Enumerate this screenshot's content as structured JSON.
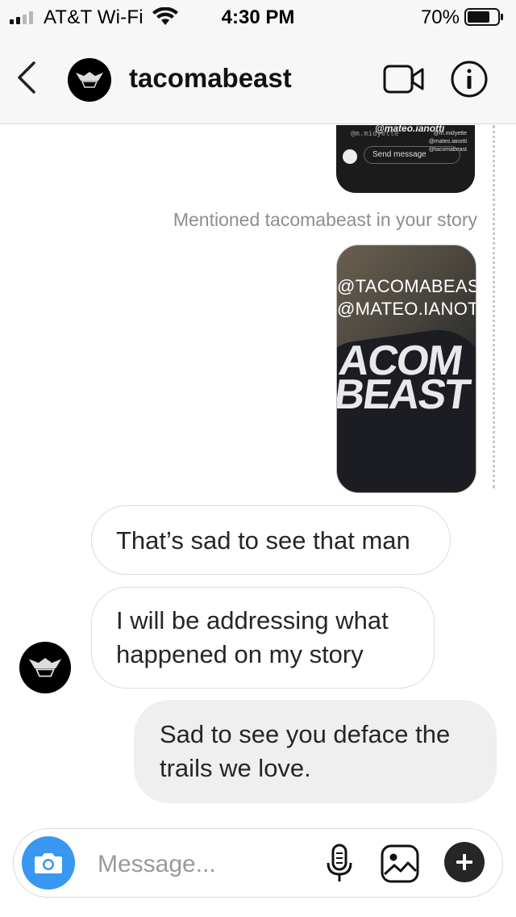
{
  "status_bar": {
    "carrier": "AT&T Wi-Fi",
    "time": "4:30 PM",
    "battery_percent": "70%",
    "battery_level": 0.7,
    "signal_bars": 2
  },
  "header": {
    "username": "tacomabeast",
    "avatar_logo_text": "TACOMABEAST"
  },
  "story_preview": {
    "mention": "@mateo.ianotti",
    "tag_left": "@m.midyette",
    "tags_right": [
      "@m.midyette",
      "@mateo.ianotti",
      "@tacomabeast"
    ],
    "send_placeholder": "Send message"
  },
  "mention_notice": "Mentioned tacomabeast in your story",
  "story_card": {
    "tag1": "@TACOMABEAST",
    "tag2": "@MATEO.IANOTTI",
    "shirt_text": [
      "ACOM",
      "BEAST"
    ]
  },
  "messages": [
    {
      "text": "That’s sad to see that man",
      "from": "other"
    },
    {
      "text": "I will be addressing what happened on my story",
      "from": "other"
    },
    {
      "text": "Sad to see you deface the trails we love.",
      "from": "me"
    }
  ],
  "composer": {
    "placeholder": "Message..."
  },
  "colors": {
    "accent": "#3897f0",
    "bubble_in": "#efefef",
    "muted_text": "#8e8e8e"
  }
}
